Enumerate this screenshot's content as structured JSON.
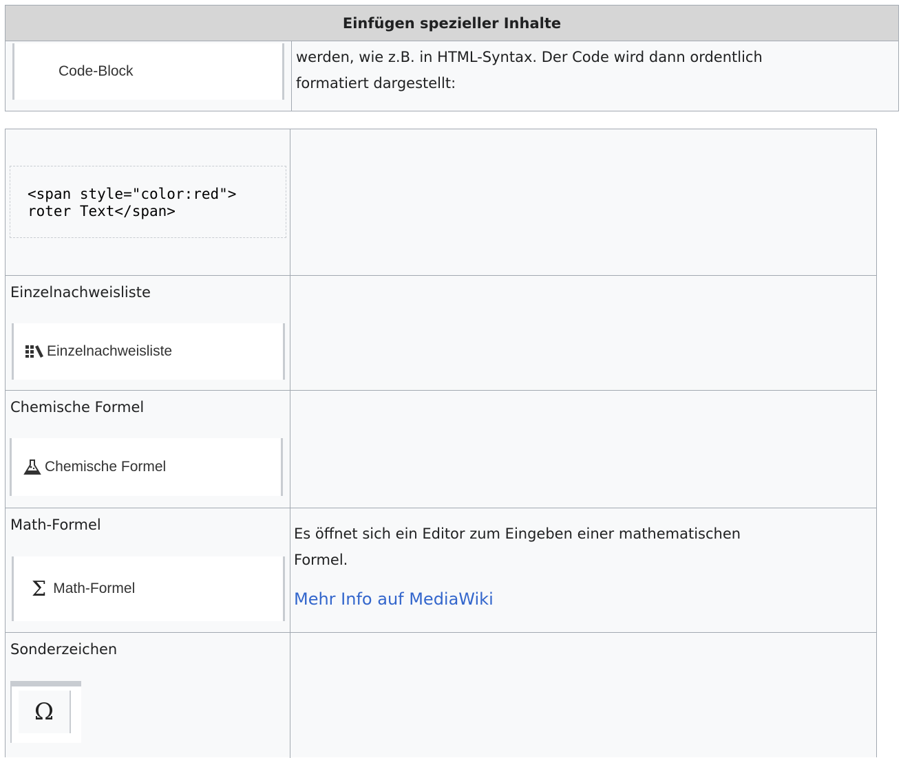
{
  "table1": {
    "header": "Einfügen spezieller Inhalte",
    "button_label": "Code-Block",
    "description_line1": "werden, wie z.B. in HTML-Syntax. Der Code wird dann ordentlich",
    "description_line2": "formatiert dargestellt:"
  },
  "table2": {
    "code_sample": "<span style=\"color:red\">\nroter Text</span>",
    "rows": [
      {
        "label": "Einzelnachweisliste",
        "button_label": "Einzelnachweisliste",
        "icon": "books-icon",
        "description": ""
      },
      {
        "label": "Chemische Formel",
        "button_label": "Chemische Formel",
        "icon": "flask-icon",
        "description": ""
      },
      {
        "label": "Math-Formel",
        "button_label": "Math-Formel",
        "icon": "sigma-icon",
        "description_line1": "Es öffnet sich ein Editor zum Eingeben einer mathematischen",
        "description_line2": "Formel.",
        "link_text": "Mehr Info auf MediaWiki"
      },
      {
        "label": "Sonderzeichen",
        "button_label": "Ω",
        "icon": "omega-icon",
        "description": ""
      }
    ]
  },
  "colors": {
    "header_bg": "#d6d6d6",
    "cell_bg": "#f8f9fa",
    "border": "#a2a9b1",
    "link": "#3366cc"
  }
}
